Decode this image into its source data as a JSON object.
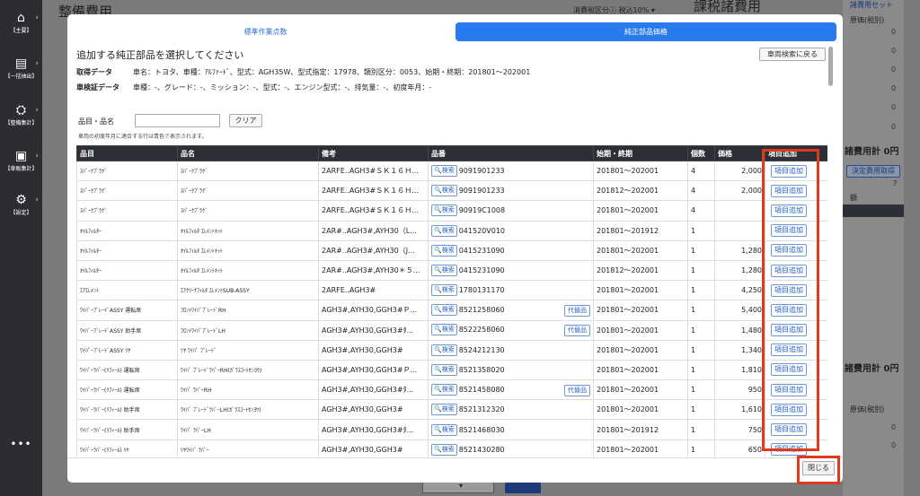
{
  "sidebar": {
    "items": [
      {
        "icon": "home-icon",
        "glyph": "⌂",
        "label": "【主要】"
      },
      {
        "icon": "document-arrow-icon",
        "glyph": "▤",
        "label": "【一括抽出】"
      },
      {
        "icon": "car-wrench-icon",
        "glyph": "⛭",
        "label": "【整備集計】"
      },
      {
        "icon": "car-list-icon",
        "glyph": "▣",
        "label": "【車販集計】"
      },
      {
        "icon": "gear-icon",
        "glyph": "⚙",
        "label": "【設定】"
      }
    ],
    "more": "•••"
  },
  "background": {
    "title_left": "整備費用",
    "title_right": "課税諸費用",
    "tax_label": "消費税区分",
    "tax_value": "税込10%",
    "right_link_top": "諸費用セット",
    "right_price_header": "原価(税別)",
    "right_total_1": "諸費用計 0円",
    "right_btn": "決定費用取得",
    "right_col_2": "額",
    "right_total_2": "諸費用計 0円",
    "right_price_header_2": "原価(税別)",
    "zero": "0"
  },
  "modal": {
    "tabs": [
      {
        "label": "標準作業点数",
        "active": false
      },
      {
        "label": "純正部品価格",
        "active": true
      }
    ],
    "heading": "追加する純正部品を選択してください",
    "back_button": "車両検索に戻る",
    "acquired_label": "取得データ",
    "acquired_value": "車名：トヨタ、車種：ｱﾙﾌｧｰﾄﾞ、型式：AGH35W、型式指定：17978、類別区分：0053、始期・終期：201801〜202001",
    "inspection_label": "車検証データ",
    "inspection_value": "車種：-、グレード：-、ミッション：-、型式：-、エンジン型式：-、排気量：-、初度年月：-",
    "filter_label": "品目・品名",
    "filter_placeholder": "",
    "clear_button": "クリア",
    "note": "車両の初度年月に適合する行は青色で表示されます。",
    "columns": [
      "品目",
      "品名",
      "備考",
      "品番",
      "始期・終期",
      "個数",
      "価格",
      "項目追加"
    ],
    "search_label": "🔍検索",
    "alt_label": "代替品",
    "add_label": "項目追加",
    "close_button": "閉じる",
    "rows": [
      {
        "item": "ｽﾊﾟｰｸﾌﾟﾗｸﾞ",
        "name": "ｽﾊﾟｰｸﾌﾟﾗｸﾞ",
        "remark": "2ARFE..AGH3#ＳＫ１６Ｈ...",
        "part_no": "9091901233",
        "alt": false,
        "period": "201801〜202001",
        "qty": "4",
        "price": "2,000"
      },
      {
        "item": "ｽﾊﾟｰｸﾌﾟﾗｸﾞ",
        "name": "ｽﾊﾟｰｸﾌﾟﾗｸﾞ",
        "remark": "2ARFE..AGH3#ＳＫ１６Ｈ...",
        "part_no": "9091901233",
        "alt": false,
        "period": "201812〜202001",
        "qty": "4",
        "price": "2,000"
      },
      {
        "item": "ｽﾊﾟｰｸﾌﾟﾗｸﾞ",
        "name": "ｽﾊﾟｰｸﾌﾟﾗｸﾞ",
        "remark": "2ARFE..AGH3#ＳＫ１６Ｈ...",
        "part_no": "90919C1008",
        "alt": false,
        "period": "201801〜202001",
        "qty": "4",
        "price": ""
      },
      {
        "item": "ｵｲﾙﾌｨﾙﾀｰ",
        "name": "ｵｲﾙﾌｨﾙﾀ ｴﾚﾒﾝﾄｷｯﾄ",
        "remark": "2AR#..AGH3#,AYH30（L...",
        "part_no": "041520V010",
        "alt": false,
        "period": "201801〜201912",
        "qty": "1",
        "price": ""
      },
      {
        "item": "ｵｲﾙﾌｨﾙﾀｰ",
        "name": "ｵｲﾙﾌｨﾙﾀ ｴﾚﾒﾝﾄｷｯﾄ",
        "remark": "2AR#..AGH3#,AYH30（J...",
        "part_no": "0415231090",
        "alt": false,
        "period": "201801〜202001",
        "qty": "1",
        "price": "1,280"
      },
      {
        "item": "ｵｲﾙﾌｨﾙﾀｰ",
        "name": "ｵｲﾙﾌｨﾙﾀ ｴﾚﾒﾝﾄｷｯﾄ",
        "remark": "2AR#..AGH3#,AYH30＊５...",
        "part_no": "0415231090",
        "alt": false,
        "period": "201812〜202001",
        "qty": "1",
        "price": "1,280"
      },
      {
        "item": "ｴｱｴﾚﾒﾝﾄ",
        "name": "ｴｱｸﾘｰﾅﾌｨﾙﾀ ｴﾚﾒﾝﾄSUB-ASSY",
        "remark": "2ARFE..AGH3#",
        "part_no": "1780131170",
        "alt": false,
        "period": "201801〜202001",
        "qty": "1",
        "price": "4,250"
      },
      {
        "item": "ﾜｲﾊﾟｰﾌﾞﾚｰﾄﾞASSY 運転席",
        "name": "ﾌﾛﾝﾄﾜｲﾊﾟﾌﾞﾚｰﾄﾞRH",
        "remark": "AGH3#,AYH30,GGH3#Ｐ...",
        "part_no": "8521258060",
        "alt": true,
        "period": "201801〜202001",
        "qty": "1",
        "price": "5,400"
      },
      {
        "item": "ﾜｲﾊﾟｰﾌﾞﾚｰﾄﾞASSY 助手席",
        "name": "ﾌﾛﾝﾄﾜｲﾊﾟﾌﾞﾚｰﾄﾞLH",
        "remark": "AGH3#,AYH30,GGH3#ﾀ...",
        "part_no": "8522258060",
        "alt": true,
        "period": "201801〜202001",
        "qty": "1",
        "price": "1,480"
      },
      {
        "item": "ﾜｲﾊﾟｰﾌﾞﾚｰﾄﾞASSY ﾘﾔ",
        "name": "ﾘﾔ ﾜｲﾊﾟ ﾌﾞﾚｰﾄﾞ",
        "remark": "AGH3#,AYH30,GGH3#",
        "part_no": "8524212130",
        "alt": false,
        "period": "201801〜202001",
        "qty": "1",
        "price": "1,340"
      },
      {
        "item": "ﾜｲﾊﾟｰﾗﾊﾞｰ(ﾘﾌｨｰﾙ) 運転席",
        "name": "ﾜｲﾊﾟ ﾌﾞﾚｰﾄﾞﾗﾊﾞｰRH(ｶﾞﾗｽｺｰﾄｾﾝﾖｳ)",
        "remark": "AGH3#,AYH30,GGH3#Ｐ...",
        "part_no": "8521358020",
        "alt": false,
        "period": "201801〜202001",
        "qty": "1",
        "price": "1,810"
      },
      {
        "item": "ﾜｲﾊﾟｰﾗﾊﾞｰ(ﾘﾌｨｰﾙ) 運転席",
        "name": "ﾜｲﾊﾟ ﾗﾊﾞｰRH",
        "remark": "AGH3#,AYH30,GGH3#ﾀ...",
        "part_no": "8521458080",
        "alt": true,
        "period": "201801〜202001",
        "qty": "1",
        "price": "950"
      },
      {
        "item": "ﾜｲﾊﾟｰﾗﾊﾞｰ(ﾘﾌｨｰﾙ) 助手席",
        "name": "ﾜｲﾊﾟ ﾌﾞﾚｰﾄﾞﾗﾊﾞｰLH(ｶﾞﾗｽｺｰﾄｾﾝﾖｳ)",
        "remark": "AGH3#,AYH30,GGH3#",
        "part_no": "8521312320",
        "alt": false,
        "period": "201801〜202001",
        "qty": "1",
        "price": "1,610"
      },
      {
        "item": "ﾜｲﾊﾟｰﾗﾊﾞｰ(ﾘﾌｨｰﾙ) 助手席",
        "name": "ﾜｲﾊﾟ ﾗﾊﾞｰLH",
        "remark": "AGH3#,AYH30,GGH3#ﾀ...",
        "part_no": "8521468030",
        "alt": false,
        "period": "201801〜201912",
        "qty": "1",
        "price": "750"
      },
      {
        "item": "ﾜｲﾊﾟｰﾗﾊﾞｰ(ﾘﾌｨｰﾙ) ﾘﾔ",
        "name": "ﾘﾔﾜｲﾊﾟ ﾗﾊﾞｰ",
        "remark": "AGH3#,AYH30,GGH3#",
        "part_no": "8521430280",
        "alt": false,
        "period": "201801〜202001",
        "qty": "1",
        "price": "650"
      }
    ]
  },
  "colors": {
    "accent": "#2979ef",
    "highlight_box": "#e03a1e",
    "table_header": "#2c2f36",
    "sidebar": "#2b2d33"
  }
}
